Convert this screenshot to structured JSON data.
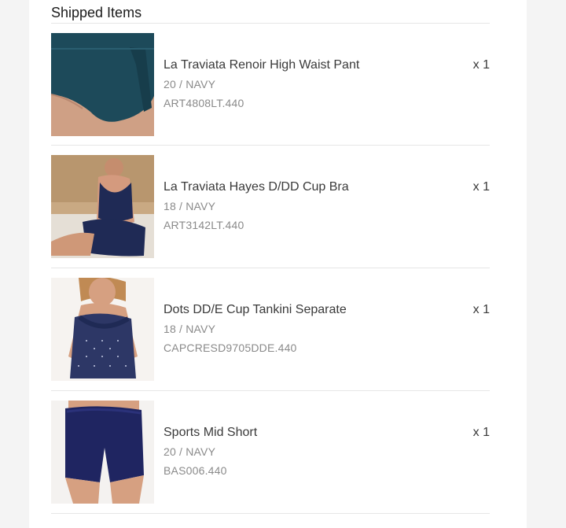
{
  "section": {
    "title": "Shipped Items"
  },
  "items": [
    {
      "name": "La Traviata Renoir High Waist Pant",
      "variant": "20 / NAVY",
      "sku": "ART4808LT.440",
      "qty": "x 1",
      "image_icon": "swim-pant-photo"
    },
    {
      "name": "La Traviata Hayes D/DD Cup Bra",
      "variant": "18 / NAVY",
      "sku": "ART3142LT.440",
      "qty": "x 1",
      "image_icon": "swim-bra-photo"
    },
    {
      "name": "Dots DD/E Cup Tankini Separate",
      "variant": "18 / NAVY",
      "sku": "CAPCRESD9705DDE.440",
      "qty": "x 1",
      "image_icon": "tankini-photo"
    },
    {
      "name": "Sports Mid Short",
      "variant": "20 / NAVY",
      "sku": "BAS006.440",
      "qty": "x 1",
      "image_icon": "swim-short-photo"
    }
  ],
  "colors": {
    "navy": "#1f2a55",
    "teal": "#1d4a5a",
    "skin": "#d9a489",
    "divider": "#e6e6e6"
  }
}
